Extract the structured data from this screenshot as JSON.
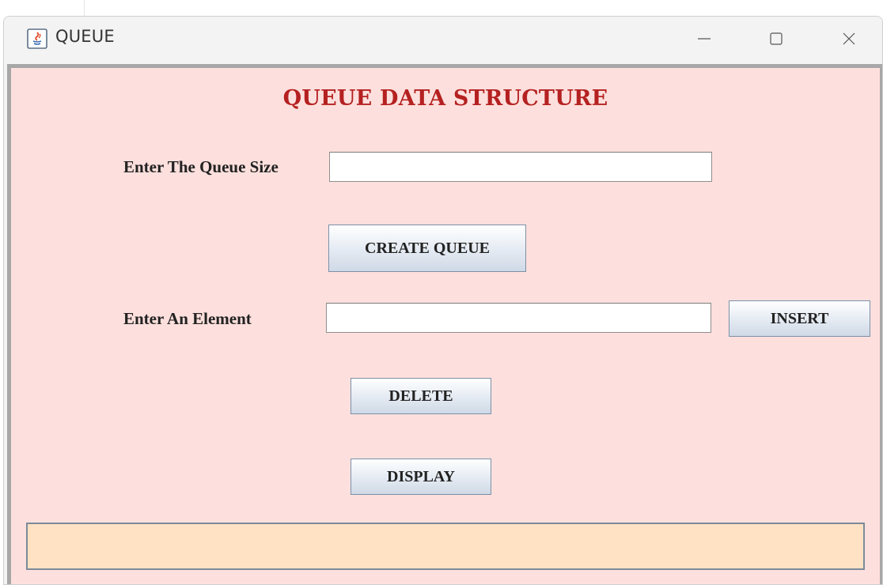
{
  "window": {
    "title": "QUEUE",
    "title_icon": "java-icon",
    "controls": {
      "minimize_glyph": "—",
      "maximize_glyph": "☐",
      "close_glyph": "✕"
    }
  },
  "form": {
    "heading": "QUEUE DATA STRUCTURE",
    "queue_size_label": "Enter The Queue Size",
    "queue_size_value": "",
    "create_button": "CREATE QUEUE",
    "element_label": "Enter An Element",
    "element_value": "",
    "insert_button": "INSERT",
    "delete_button": "DELETE",
    "display_button": "DISPLAY",
    "output_text": ""
  },
  "colors": {
    "client_background": "#fde0dd",
    "heading": "#b52121",
    "output_background": "#fee2c3"
  }
}
